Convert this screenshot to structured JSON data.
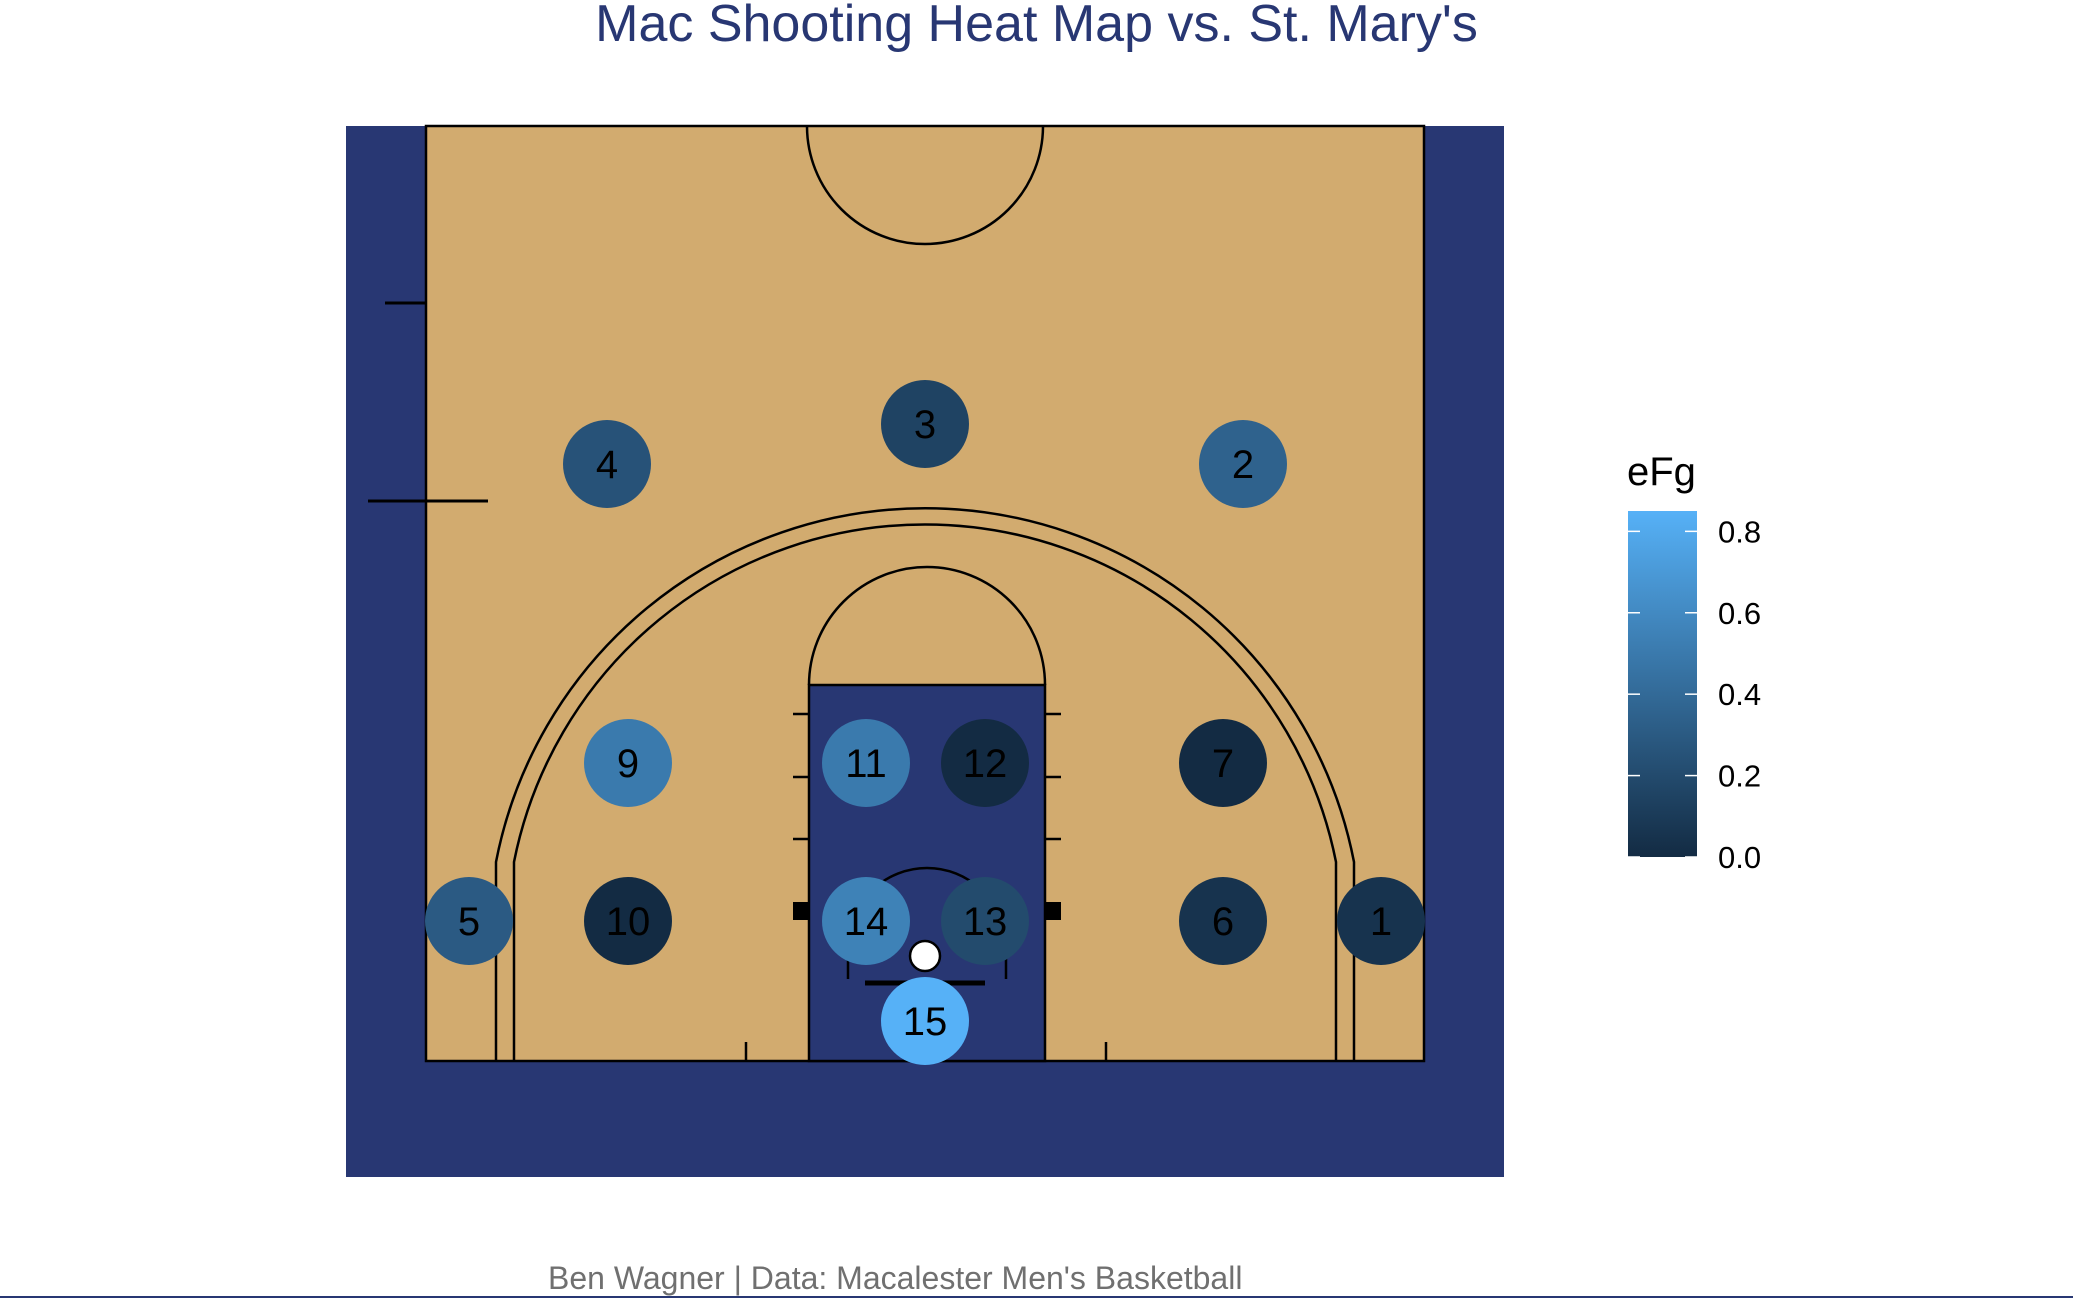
{
  "title": "Mac Shooting Heat Map vs. St. Mary's",
  "caption": "Ben Wagner | Data: Macalester Men's Basketball",
  "colors": {
    "title": "#283773",
    "background_panel": "#283773",
    "court_wood": "#d2ab6f",
    "paint": "#283773",
    "lines": "#000000",
    "rim": "#ffffff",
    "scale_low": "#132b43",
    "scale_high": "#56b1f7"
  },
  "chart_data": {
    "type": "scatter",
    "subtype": "basketball half-court shot zone heat map",
    "color_variable": "eFg",
    "legend": {
      "title": "eFg",
      "position": "right",
      "ticks": [
        "0.0",
        "0.2",
        "0.4",
        "0.6",
        "0.8"
      ],
      "range": [
        0.0,
        0.85
      ]
    },
    "zones": [
      {
        "label": "1",
        "efg": 0.05
      },
      {
        "label": "2",
        "efg": 0.35
      },
      {
        "label": "3",
        "efg": 0.15
      },
      {
        "label": "4",
        "efg": 0.25
      },
      {
        "label": "5",
        "efg": 0.3
      },
      {
        "label": "6",
        "efg": 0.05
      },
      {
        "label": "7",
        "efg": 0.0
      },
      {
        "label": "9",
        "efg": 0.5
      },
      {
        "label": "10",
        "efg": 0.0
      },
      {
        "label": "11",
        "efg": 0.5
      },
      {
        "label": "12",
        "efg": 0.0
      },
      {
        "label": "13",
        "efg": 0.2
      },
      {
        "label": "14",
        "efg": 0.55
      },
      {
        "label": "15",
        "efg": 0.85
      }
    ],
    "grid": false
  }
}
